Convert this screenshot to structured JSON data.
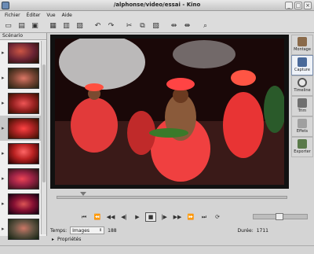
{
  "window": {
    "title": "/alphonse/video/essai - Kino"
  },
  "menu": [
    {
      "label": "Fichier"
    },
    {
      "label": "Éditer"
    },
    {
      "label": "Vue"
    },
    {
      "label": "Aide"
    }
  ],
  "toolbar": [
    {
      "icon": "new-file-icon",
      "glyph": "▭"
    },
    {
      "icon": "open-folder-icon",
      "glyph": "▤"
    },
    {
      "icon": "save-icon",
      "glyph": "▣"
    },
    {
      "icon": "save-all-icon",
      "glyph": "▦"
    },
    {
      "icon": "export-icon",
      "glyph": "▥"
    },
    {
      "icon": "properties-icon",
      "glyph": "▨"
    },
    {
      "icon": "undo-icon",
      "glyph": "↶"
    },
    {
      "icon": "redo-icon",
      "glyph": "↷"
    },
    {
      "icon": "cut-icon",
      "glyph": "✂"
    },
    {
      "icon": "copy-icon",
      "glyph": "⧉"
    },
    {
      "icon": "paste-icon",
      "glyph": "▧"
    },
    {
      "icon": "split-icon",
      "glyph": "⇹"
    },
    {
      "icon": "join-icon",
      "glyph": "⇼"
    },
    {
      "icon": "zoom-icon",
      "glyph": "⌕"
    }
  ],
  "sidebar": {
    "header": "Scénario"
  },
  "right_tabs": [
    {
      "label": "Montage",
      "color": "#8a6a4a"
    },
    {
      "label": "Capture",
      "color": "#4a6a9a"
    },
    {
      "label": "Timeline",
      "color": "#6a6a6a"
    },
    {
      "label": "Trim",
      "color": "#707070"
    },
    {
      "label": "Effets",
      "color": "#a0a0a0"
    },
    {
      "label": "Exporter",
      "color": "#5a7a4a"
    }
  ],
  "transport": {
    "buttons": [
      {
        "icon": "first-scene-icon",
        "glyph": "⏮"
      },
      {
        "icon": "prev-scene-icon",
        "glyph": "⏪"
      },
      {
        "icon": "rewind-icon",
        "glyph": "◀◀"
      },
      {
        "icon": "prev-frame-icon",
        "glyph": "◀|"
      },
      {
        "icon": "play-icon",
        "glyph": "▶"
      },
      {
        "icon": "stop-icon",
        "glyph": "■"
      },
      {
        "icon": "next-frame-icon",
        "glyph": "|▶"
      },
      {
        "icon": "forward-icon",
        "glyph": "▶▶"
      },
      {
        "icon": "next-scene-icon",
        "glyph": "⏩"
      },
      {
        "icon": "last-scene-icon",
        "glyph": "⏭"
      },
      {
        "icon": "loop-icon",
        "glyph": "⟳"
      }
    ]
  },
  "position": {
    "time_label": "Temps:",
    "mode_value": "Images",
    "frame": "188",
    "duration_label": "Durée:",
    "duration_value": "1711"
  },
  "properties": {
    "label": "Propriétés"
  }
}
